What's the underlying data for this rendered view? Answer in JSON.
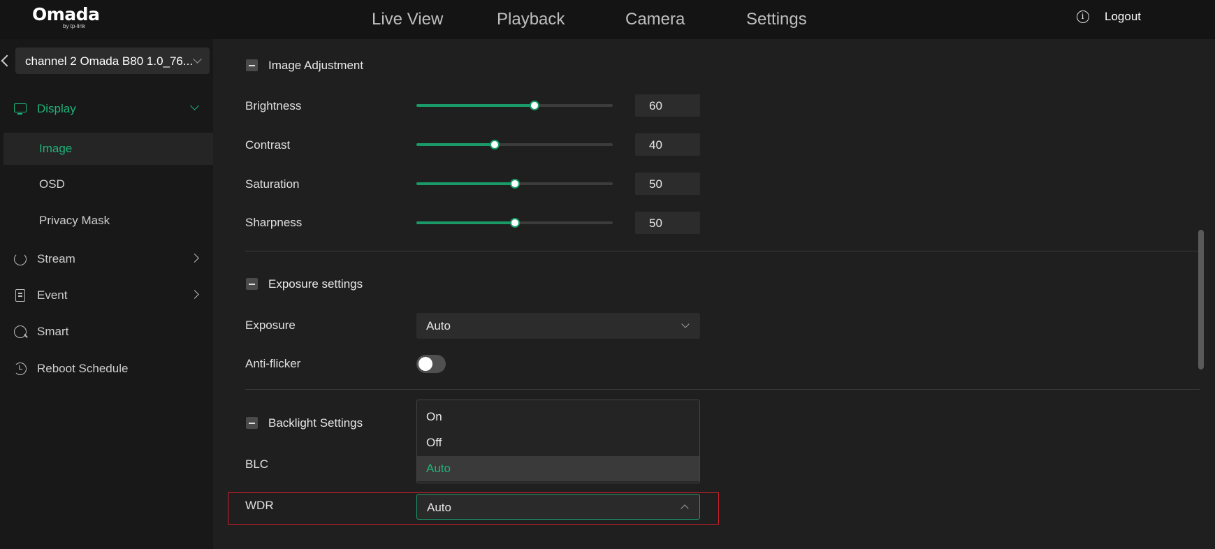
{
  "header": {
    "logo_main": "Omada",
    "logo_sub": "by tp-link",
    "nav": [
      "Live View",
      "Playback",
      "Camera",
      "Settings"
    ],
    "logout": "Logout"
  },
  "sidebar": {
    "channel": "channel 2 Omada B80 1.0_76...",
    "items": [
      {
        "label": "Display",
        "icon": "monitor-icon",
        "expanded": true
      },
      {
        "label": "Stream",
        "icon": "refresh-icon"
      },
      {
        "label": "Event",
        "icon": "document-icon"
      },
      {
        "label": "Smart",
        "icon": "smart-analysis-icon"
      },
      {
        "label": "Reboot Schedule",
        "icon": "reboot-icon"
      }
    ],
    "subitems": [
      {
        "label": "Image",
        "active": true
      },
      {
        "label": "OSD"
      },
      {
        "label": "Privacy Mask"
      }
    ]
  },
  "image_adjustment": {
    "title": "Image Adjustment",
    "brightness": {
      "label": "Brightness",
      "value": "60"
    },
    "contrast": {
      "label": "Contrast",
      "value": "40"
    },
    "saturation": {
      "label": "Saturation",
      "value": "50"
    },
    "sharpness": {
      "label": "Sharpness",
      "value": "50"
    }
  },
  "exposure": {
    "title": "Exposure settings",
    "exposure_label": "Exposure",
    "exposure_value": "Auto",
    "antiflicker_label": "Anti-flicker",
    "antiflicker_on": false
  },
  "backlight": {
    "title": "Backlight Settings",
    "blc_label": "BLC",
    "wdr_label": "WDR",
    "wdr_value": "Auto",
    "options": [
      "On",
      "Off",
      "Auto"
    ],
    "selected_option": "Auto"
  },
  "colors": {
    "accent": "#1eb37a",
    "highlight_border": "#d0202a",
    "background": "#1f1f1f"
  }
}
